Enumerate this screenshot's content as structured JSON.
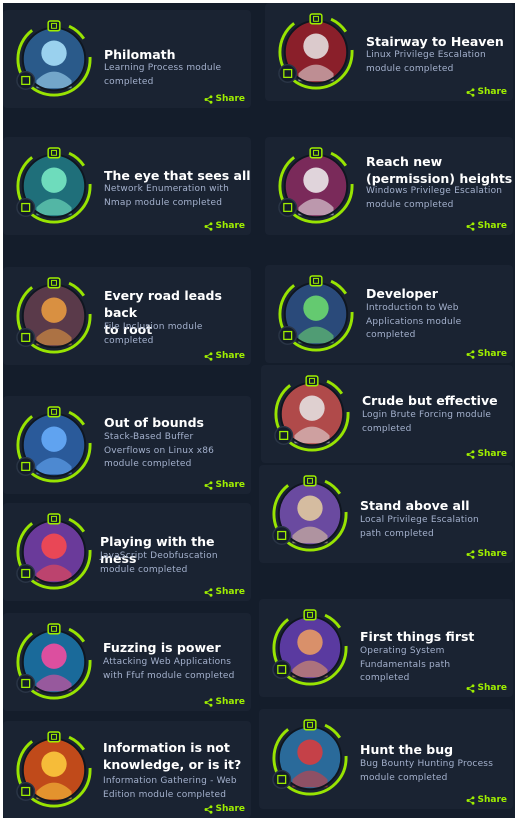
{
  "share_label": "Share",
  "colors": {
    "accent": "#9fef00",
    "card_bg": "#1a2332",
    "page_bg": "#141d2b",
    "text": "#ffffff",
    "muted": "#a4b1cd"
  },
  "badges": [
    {
      "title": "Philomath",
      "desc": "Learning Process module\ncompleted",
      "icon": "reading-robot-badge-icon",
      "bg": "#2a5a8a",
      "fg": "#aee6ff"
    },
    {
      "title": "Stairway to Heaven",
      "desc": "Linux Privilege Escalation\nmodule completed",
      "icon": "stairway-badge-icon",
      "bg": "#8a1f2a",
      "fg": "#e9e9e9"
    },
    {
      "title": "The eye that sees all",
      "desc": "Network Enumeration with\nNmap module completed",
      "icon": "eye-badge-icon",
      "bg": "#1f6f7a",
      "fg": "#7df0c8"
    },
    {
      "title": "Reach new\n(permission) heights",
      "desc": "Windows Privilege Escalation\nmodule completed",
      "icon": "yeti-badge-icon",
      "bg": "#7a2a5a",
      "fg": "#f2f2f2"
    },
    {
      "title": "Every road leads back\nto root",
      "desc": "File Inclusion module\ncompleted",
      "icon": "road-badge-icon",
      "bg": "#5a3a4a",
      "fg": "#f0a040"
    },
    {
      "title": "Developer",
      "desc": "Introduction to Web\nApplications module\ncompleted",
      "icon": "developer-badge-icon",
      "bg": "#2a4a7a",
      "fg": "#6fe06f"
    },
    {
      "title": "Out of bounds",
      "desc": "Stack-Based Buffer\nOverflows on Linux x86\nmodule completed",
      "icon": "knight-badge-icon",
      "bg": "#2a5a9a",
      "fg": "#6ab0ff"
    },
    {
      "title": "Crude but effective",
      "desc": "Login Brute Forcing module\ncompleted",
      "icon": "robot-face-badge-icon",
      "bg": "#b04a4a",
      "fg": "#e8e8e8"
    },
    {
      "title": "Playing with the mess",
      "desc": "JavaScript Deobfuscation\nmodule completed",
      "icon": "cat-badge-icon",
      "bg": "#6a3a9a",
      "fg": "#ff4a4a"
    },
    {
      "title": "Stand above all",
      "desc": "Local Privilege Escalation\npath completed",
      "icon": "wizard-badge-icon",
      "bg": "#6a4aa0",
      "fg": "#e8d0a0"
    },
    {
      "title": "Fuzzing is power",
      "desc": "Attacking Web Applications\nwith Ffuf module completed",
      "icon": "hero-badge-icon",
      "bg": "#1a6a9a",
      "fg": "#ff4aa0"
    },
    {
      "title": "First things first",
      "desc": "Operating System\nFundamentals path\ncompleted",
      "icon": "astronaut-badge-icon",
      "bg": "#5a3aa0",
      "fg": "#f0a060"
    },
    {
      "title": "Information is not\nknowledge, or is it?",
      "desc": "Information Gathering - Web\nEdition module completed",
      "icon": "masked-hero-badge-icon",
      "bg": "#c04a1a",
      "fg": "#ffd040"
    },
    {
      "title": "Hunt the bug",
      "desc": "Bug Bounty Hunting Process\nmodule completed",
      "icon": "helmet-badge-icon",
      "bg": "#2a6a9a",
      "fg": "#e03a3a"
    }
  ]
}
